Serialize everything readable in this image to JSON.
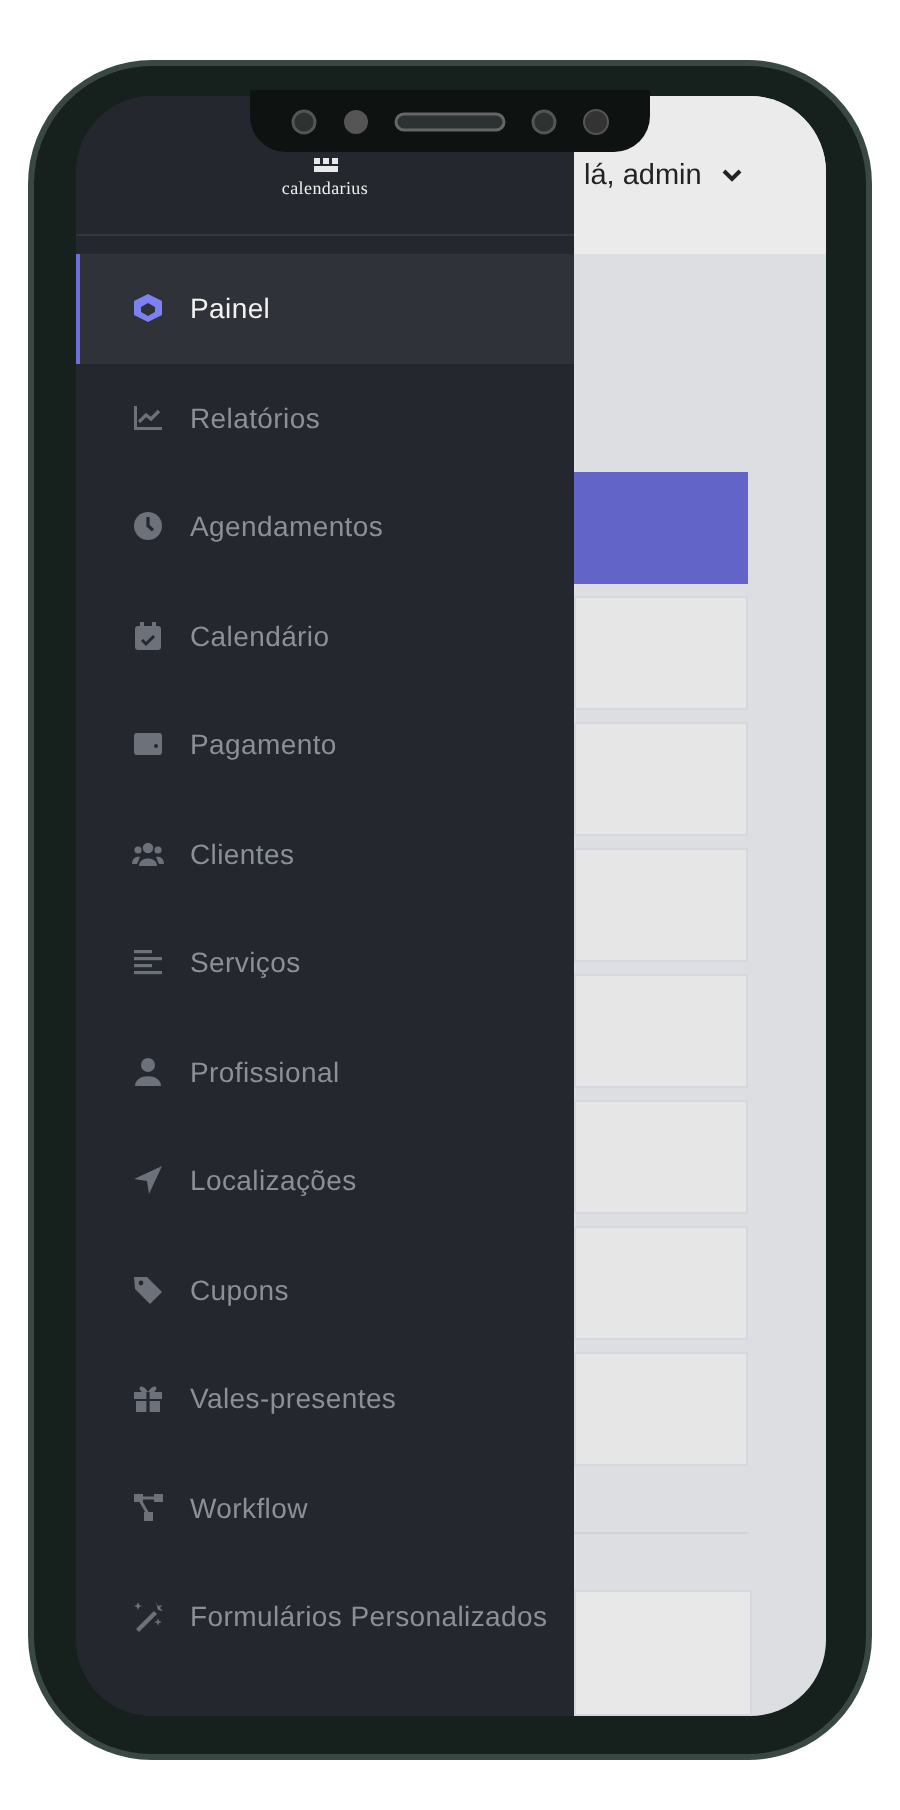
{
  "header": {
    "greeting": "lá, admin"
  },
  "sidebar": {
    "brand": "calendarius",
    "items": [
      {
        "label": "Painel",
        "kind": "cube",
        "selected": true
      },
      {
        "label": "Relatórios",
        "kind": "chart",
        "selected": false
      },
      {
        "label": "Agendamentos",
        "kind": "clock",
        "selected": false
      },
      {
        "label": "Calendário",
        "kind": "calendar",
        "selected": false
      },
      {
        "label": "Pagamento",
        "kind": "wallet",
        "selected": false
      },
      {
        "label": "Clientes",
        "kind": "users",
        "selected": false
      },
      {
        "label": "Serviços",
        "kind": "lines",
        "selected": false
      },
      {
        "label": "Profissional",
        "kind": "user",
        "selected": false
      },
      {
        "label": "Localizações",
        "kind": "arrow",
        "selected": false
      },
      {
        "label": "Cupons",
        "kind": "tag",
        "selected": false
      },
      {
        "label": "Vales-presentes",
        "kind": "gift",
        "selected": false
      },
      {
        "label": "Workflow",
        "kind": "flow",
        "selected": false
      },
      {
        "label": "Formulários Personalizados",
        "kind": "wand",
        "selected": false
      }
    ]
  }
}
